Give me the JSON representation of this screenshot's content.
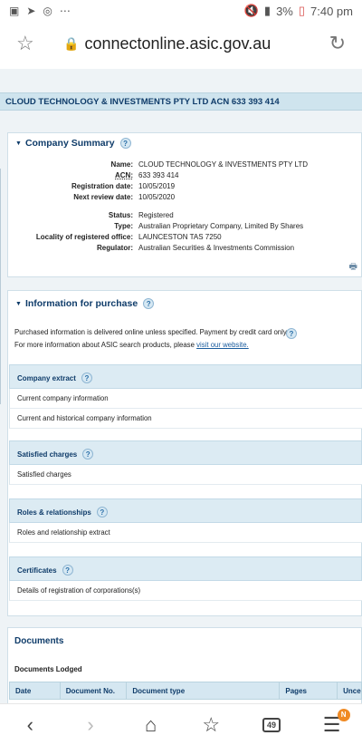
{
  "statusbar": {
    "time": "7:40 pm",
    "battery": "3%"
  },
  "browser": {
    "url": "connectonline.asic.gov.au",
    "tabs_count": "49",
    "menu_badge": "N"
  },
  "company_banner": "CLOUD TECHNOLOGY & INVESTMENTS PTY LTD ACN 633 393 414",
  "summary": {
    "title": "Company Summary",
    "help": "?",
    "rows": [
      {
        "label": "Name:",
        "value": "CLOUD TECHNOLOGY & INVESTMENTS PTY LTD"
      },
      {
        "label": "ACN:",
        "value": "633 393 414"
      },
      {
        "label": "Registration date:",
        "value": "10/05/2019"
      },
      {
        "label": "Next review date:",
        "value": "10/05/2020"
      },
      {
        "label": "Status:",
        "value": "Registered"
      },
      {
        "label": "Type:",
        "value": "Australian Proprietary Company, Limited By Shares"
      },
      {
        "label": "Locality of registered office:",
        "value": "LAUNCESTON TAS 7250"
      },
      {
        "label": "Regulator:",
        "value": "Australian Securities & Investments Commission"
      }
    ]
  },
  "purchase": {
    "title": "Information for purchase",
    "help": "?",
    "line1": "Purchased information is delivered online unless specified. Payment by credit card only.",
    "line2": "For more information about ASIC search products, please",
    "link": "visit our website.",
    "sections": [
      {
        "title": "Company extract",
        "items": [
          "Current company information",
          "Current and historical company information"
        ]
      },
      {
        "title": "Satisfied charges",
        "items": [
          "Satisfied charges"
        ]
      },
      {
        "title": "Roles & relationships",
        "items": [
          "Roles and relationship extract"
        ]
      },
      {
        "title": "Certificates",
        "items": [
          "Details of registration of corporations(s)"
        ]
      }
    ]
  },
  "documents": {
    "title": "Documents",
    "subtitle": "Documents Lodged",
    "columns": [
      "Date",
      "Document No.",
      "Document type",
      "Pages",
      "Uncer"
    ]
  }
}
